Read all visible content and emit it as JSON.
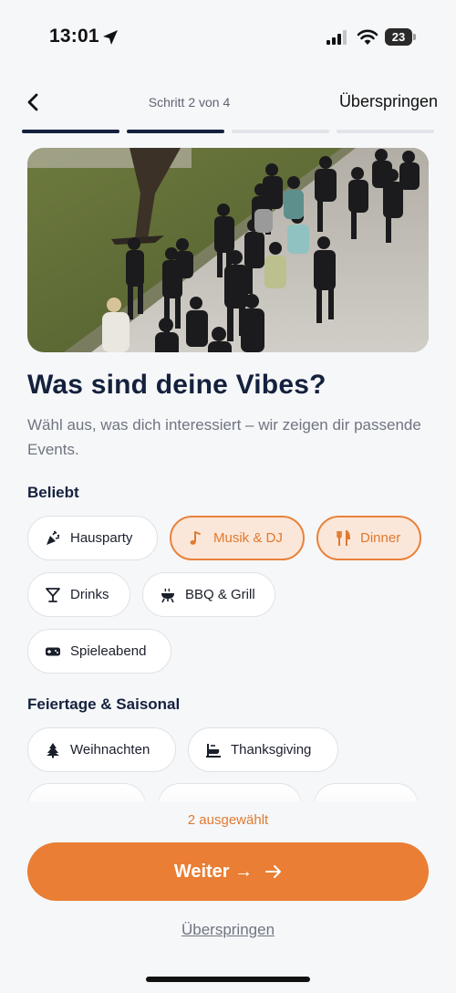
{
  "status_bar": {
    "time": "13:01",
    "battery": "23"
  },
  "header": {
    "step": "Schritt 2 von 4",
    "skip": "Überspringen",
    "progress_total": 4,
    "progress_done": 2
  },
  "title": "Was sind deine Vibes?",
  "subtitle": "Wähl aus, was dich interessiert – wir zeigen dir passende Events.",
  "sections": [
    {
      "title": "Beliebt",
      "chips": [
        {
          "label": "Hausparty",
          "icon": "party-popper-icon",
          "selected": false
        },
        {
          "label": "Musik & DJ",
          "icon": "music-note-icon",
          "selected": true
        },
        {
          "label": "Dinner",
          "icon": "fork-knife-icon",
          "selected": true
        },
        {
          "label": "Drinks",
          "icon": "cocktail-icon",
          "selected": false
        },
        {
          "label": "BBQ & Grill",
          "icon": "grill-icon",
          "selected": false
        },
        {
          "label": "Spieleabend",
          "icon": "gamepad-icon",
          "selected": false
        }
      ]
    },
    {
      "title": "Feiertage & Saisonal",
      "chips": [
        {
          "label": "Weihnachten",
          "icon": "tree-icon",
          "selected": false
        },
        {
          "label": "Thanksgiving",
          "icon": "turkey-icon",
          "selected": false
        }
      ]
    }
  ],
  "footer": {
    "selected_count": "2 ausgewählt",
    "continue": "Weiter →",
    "skip": "Überspringen"
  },
  "colors": {
    "accent": "#e97e34",
    "navy": "#14213d",
    "selected_bg": "#fbe7d9"
  }
}
